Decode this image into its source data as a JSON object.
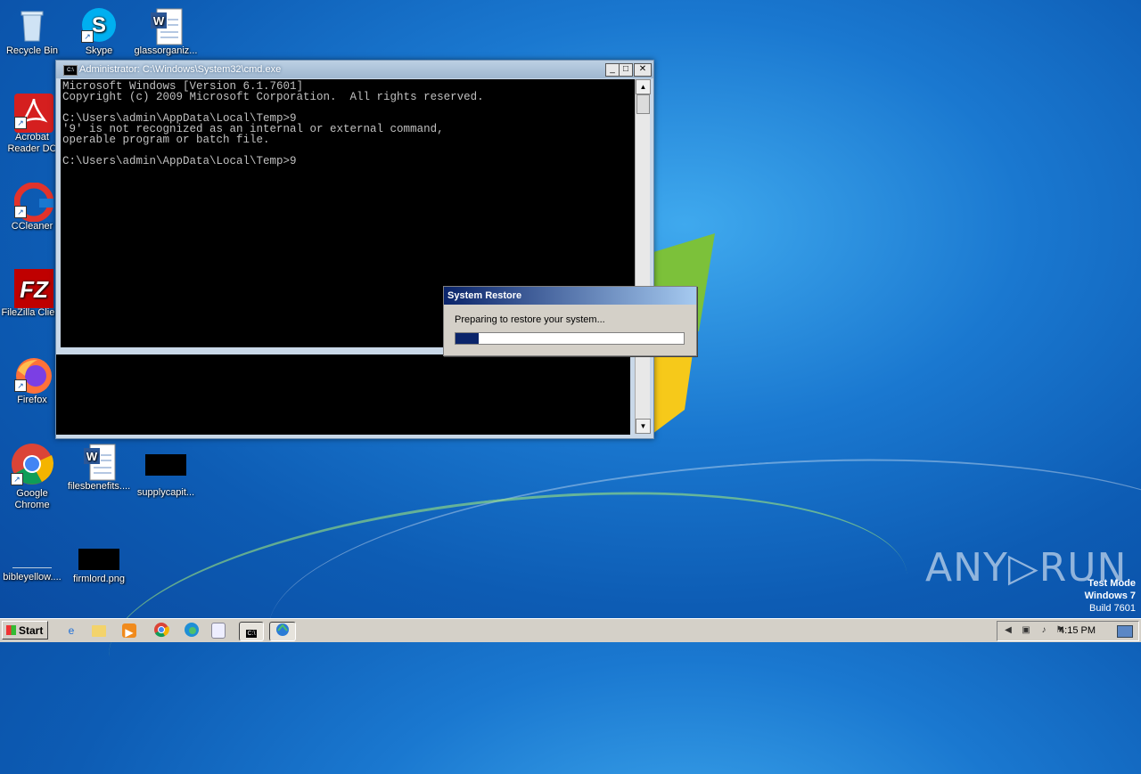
{
  "desktop": {
    "icons": [
      {
        "label": "Recycle Bin",
        "icon": "recycle-bin-icon"
      },
      {
        "label": "Skype",
        "icon": "skype-icon"
      },
      {
        "label": "glassorganiz...",
        "icon": "word-document-icon"
      },
      {
        "label": "Acrobat Reader DC",
        "icon": "acrobat-icon"
      },
      {
        "label": "CCleaner",
        "icon": "ccleaner-icon"
      },
      {
        "label": "FileZilla Client",
        "icon": "filezilla-icon"
      },
      {
        "label": "Firefox",
        "icon": "firefox-icon"
      },
      {
        "label": "Google Chrome",
        "icon": "chrome-icon"
      },
      {
        "label": "filesbenefits....",
        "icon": "word-document-icon"
      },
      {
        "label": "supplycapit...",
        "icon": "image-file-icon"
      },
      {
        "label": "bibleyellow....",
        "icon": "image-file-icon"
      },
      {
        "label": "firmlord.png",
        "icon": "image-file-icon"
      }
    ]
  },
  "cmd_window": {
    "title": "Administrator: C:\\Windows\\System32\\cmd.exe",
    "lines": [
      "Microsoft Windows [Version 6.1.7601]",
      "Copyright (c) 2009 Microsoft Corporation.  All rights reserved.",
      "",
      "C:\\Users\\admin\\AppData\\Local\\Temp>9",
      "'9' is not recognized as an internal or external command,",
      "operable program or batch file.",
      "",
      "C:\\Users\\admin\\AppData\\Local\\Temp>9"
    ],
    "minimize": "_",
    "maximize": "□",
    "close": "✕"
  },
  "restore_dialog": {
    "title": "System Restore",
    "message": "Preparing to restore your system...",
    "progress": 0.1
  },
  "watermark": {
    "brand": "ANY▷RUN",
    "test_mode": "Test Mode",
    "os": "Windows 7",
    "build": "Build 7601"
  },
  "taskbar": {
    "start_label": "Start",
    "clock": "4:15 PM",
    "pinned": [
      "ie-icon",
      "explorer-icon",
      "media-player-icon",
      "chrome-icon",
      "edge-icon",
      "notepad-icon",
      "cmd-icon",
      "system-restore-icon"
    ]
  }
}
